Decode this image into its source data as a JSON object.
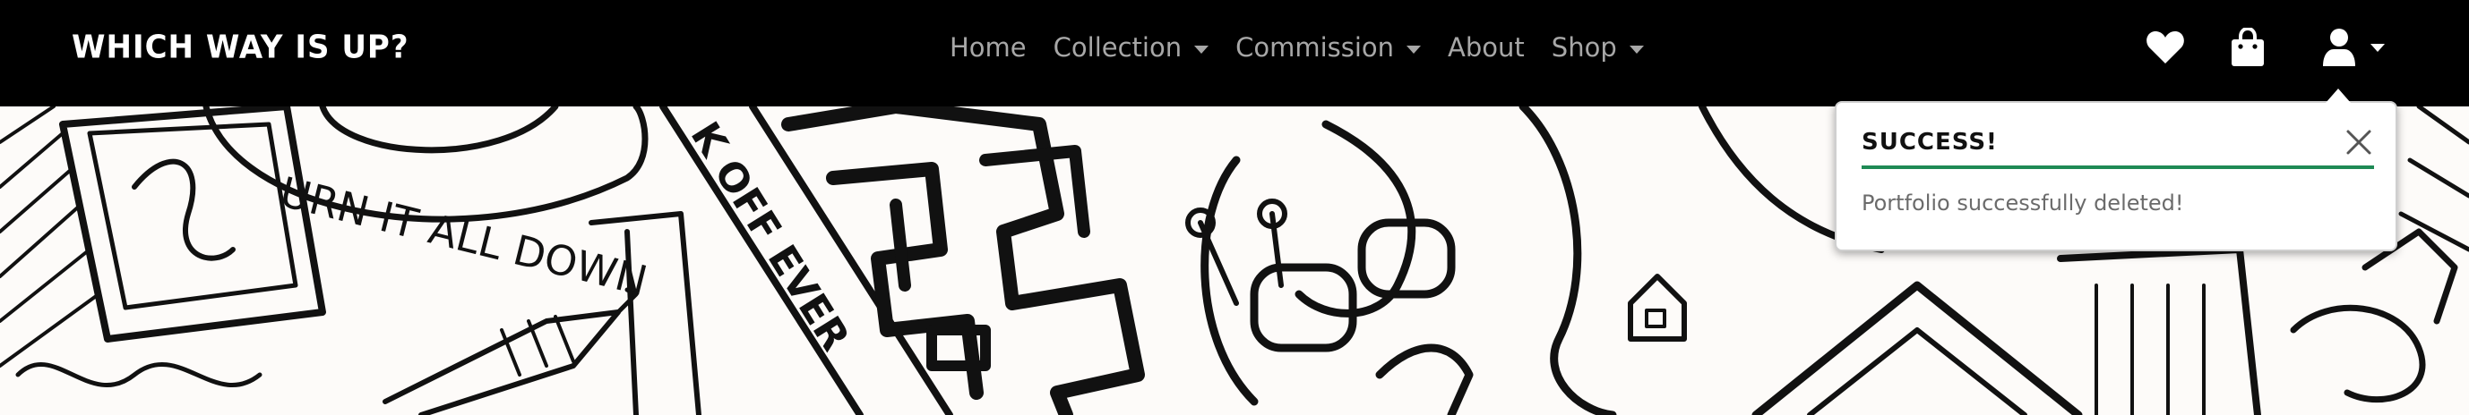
{
  "navbar": {
    "brand": "Which way is up?",
    "links": [
      {
        "label": "Home",
        "has_dropdown": false
      },
      {
        "label": "Collection",
        "has_dropdown": true
      },
      {
        "label": "Commission",
        "has_dropdown": true
      },
      {
        "label": "About",
        "has_dropdown": false
      },
      {
        "label": "Shop",
        "has_dropdown": true
      }
    ],
    "icons": [
      "heart-icon",
      "shopping-bag-icon",
      "user-icon"
    ]
  },
  "hero": {
    "image": "black and white hand-drawn doodle artwork",
    "text_fragments": [
      "URN IT ALL DOWN",
      "K OFF EVER"
    ]
  },
  "toast": {
    "title": "Success!",
    "message": "Portfolio successfully deleted!",
    "accent_color": "#1e8a55",
    "close_icon": "close-icon"
  },
  "colors": {
    "navbar_bg": "#000000",
    "nav_link": "#a7a7a7",
    "brand": "#ffffff"
  }
}
